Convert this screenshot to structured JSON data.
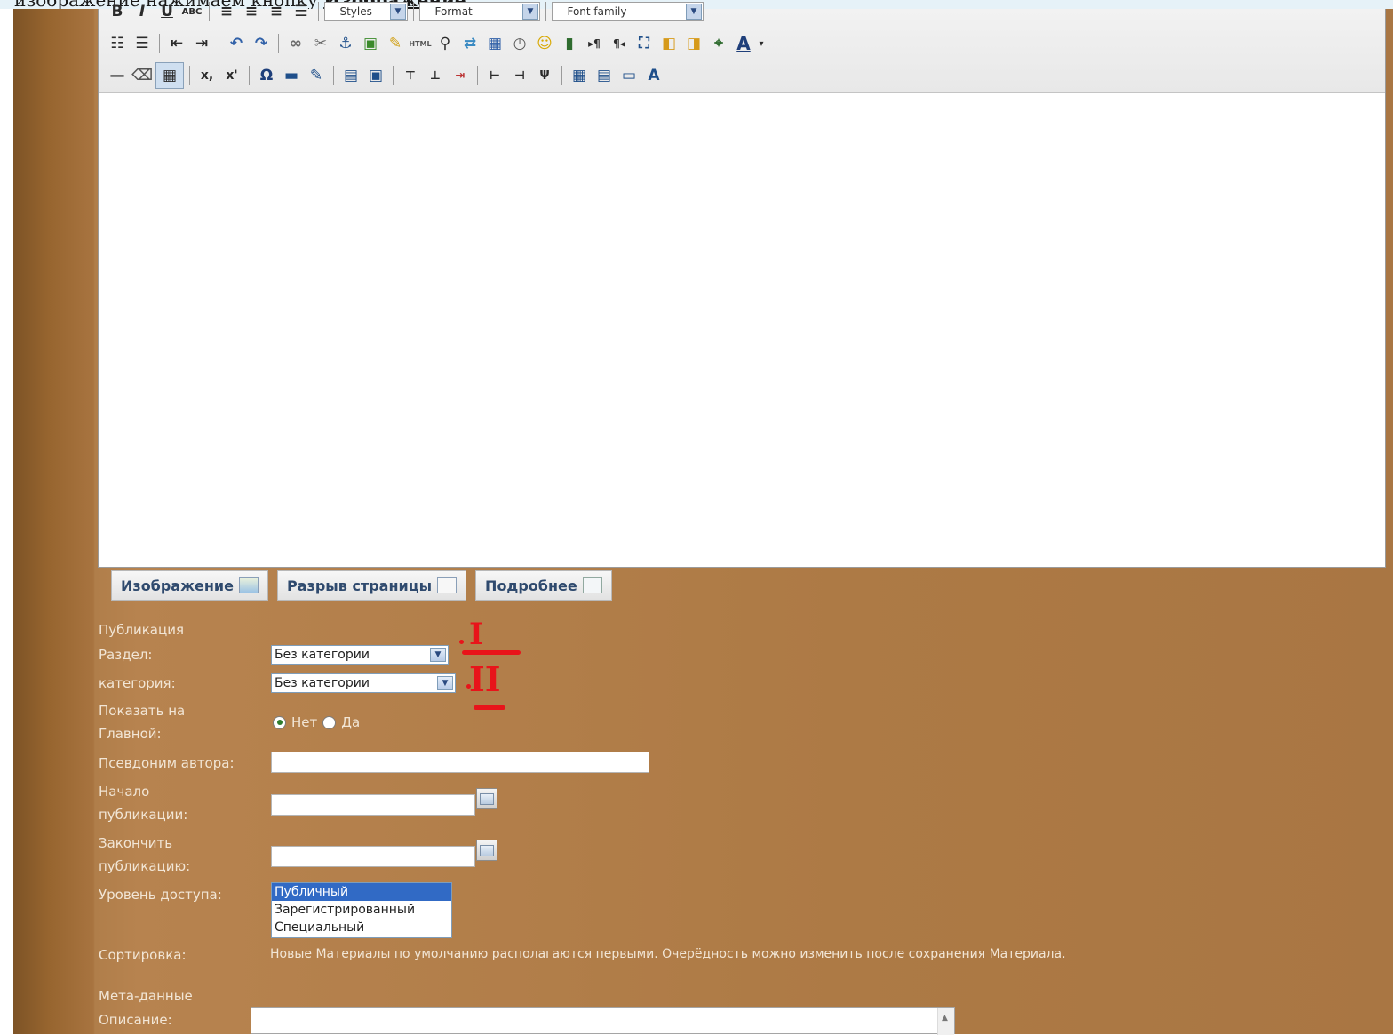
{
  "top_caption": {
    "before": "изображение нажимаем кнопку ",
    "link": "Изображение"
  },
  "toolbar": {
    "row1": {
      "bold": "B",
      "italic": "I",
      "underline": "U",
      "strike": "ABC",
      "styles_select": "-- Styles --",
      "format_select": "-- Format --",
      "font_select": "-- Font family --"
    },
    "row2": {
      "html_label": "HTML",
      "font_color": "A"
    },
    "row3": {
      "omega": "Ω",
      "sub": "x,",
      "sup": "x'"
    }
  },
  "buttons": {
    "image": "Изображение",
    "page_break": "Разрыв страницы",
    "read_more": "Подробнее"
  },
  "form": {
    "section_publication": "Публикация",
    "section_label": "Раздел:",
    "section_value": "Без категории",
    "category_label": "категория:",
    "category_value": "Без категории",
    "frontpage_label": "Показать на Главной:",
    "frontpage_no": "Нет",
    "frontpage_yes": "Да",
    "author_alias_label": "Псевдоним автора:",
    "publish_up_label": "Начало публикации:",
    "publish_down_label": "Закончить публикацию:",
    "access_label": "Уровень доступа:",
    "access_options": [
      "Публичный",
      "Зарегистрированный",
      "Специальный"
    ],
    "ordering_label": "Сортировка:",
    "ordering_note": "Новые Материалы по умолчанию располагаются первыми. Очерёдность можно изменить после сохранения Материала.",
    "meta_heading": "Мета-данные",
    "description_label": "Описание:"
  },
  "annotations": {
    "mark1": "I",
    "mark2": "II"
  }
}
